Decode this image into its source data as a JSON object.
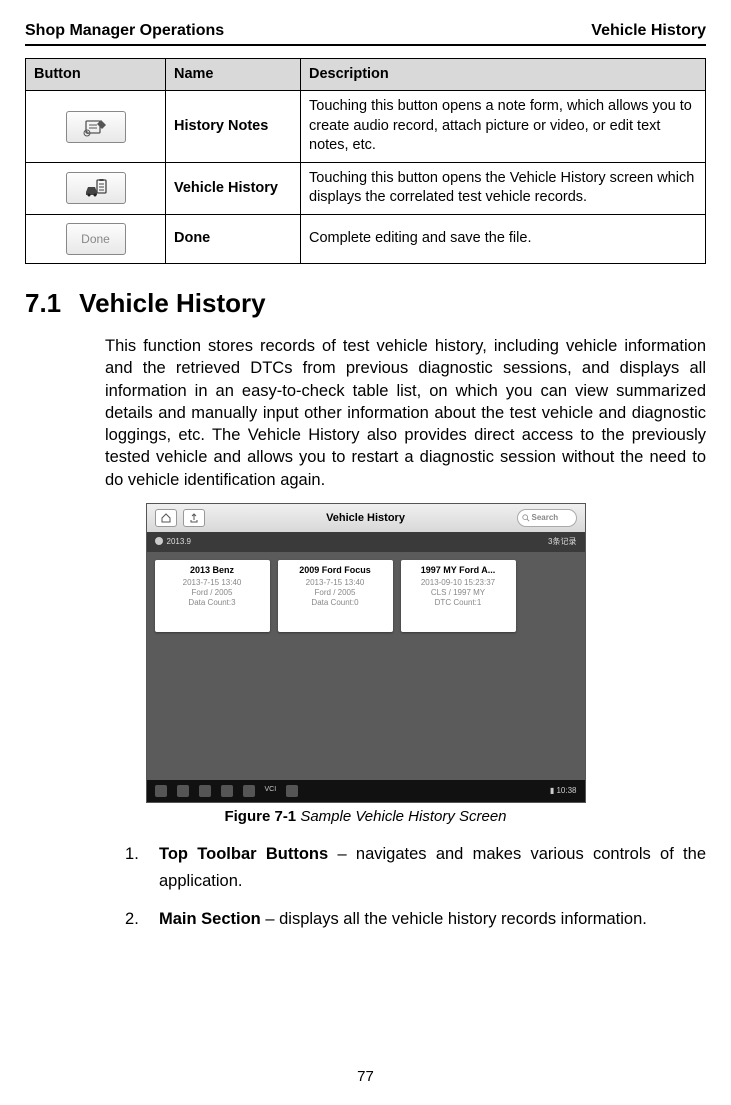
{
  "header": {
    "left": "Shop Manager Operations",
    "right": "Vehicle History"
  },
  "table": {
    "headers": [
      "Button",
      "Name",
      "Description"
    ],
    "rows": [
      {
        "icon": "history-notes-icon",
        "name": "History Notes",
        "desc": "Touching this button opens a note form, which allows you to create audio record, attach picture or video, or edit text notes, etc."
      },
      {
        "icon": "vehicle-history-icon",
        "name": "Vehicle History",
        "desc": "Touching this button opens the Vehicle History screen which displays the correlated test vehicle records."
      },
      {
        "icon": "done-button-icon",
        "icon_label": "Done",
        "name": "Done",
        "desc": "Complete editing and save the file."
      }
    ]
  },
  "section": {
    "number": "7.1",
    "title": "Vehicle History",
    "body": "This function stores records of test vehicle history, including vehicle information and the retrieved DTCs from previous diagnostic sessions, and displays all information in an easy-to-check table list, on which you can view summarized details and manually input other information about the test vehicle and diagnostic loggings, etc. The Vehicle History also provides direct access to the previously tested vehicle and allows you to restart a diagnostic session without the need to do vehicle identification again."
  },
  "screenshot": {
    "title": "Vehicle History",
    "search_placeholder": "Search",
    "sub_left": "2013.9",
    "sub_right": "3条记录",
    "cards": [
      {
        "title": "2013 Benz",
        "l1": "2013-7-15 13:40",
        "l2": "Ford / 2005",
        "l3": "Data Count:3"
      },
      {
        "title": "2009 Ford Focus",
        "l1": "2013-7-15 13:40",
        "l2": "Ford / 2005",
        "l3": "Data Count:0"
      },
      {
        "title": "1997 MY Ford A...",
        "l1": "2013-09-10 15:23:37",
        "l2": "CLS / 1997 MY",
        "l3": "DTC Count:1"
      }
    ],
    "bottom_label": "VCI",
    "bottom_time": "10:38"
  },
  "figure_caption": {
    "bold": "Figure 7-1",
    "italic": " Sample Vehicle History Screen"
  },
  "list": [
    {
      "bold": "Top Toolbar Buttons",
      "rest": " – navigates and makes various controls of the application."
    },
    {
      "bold": "Main Section",
      "rest": " – displays all the vehicle history records information."
    }
  ],
  "page_number": "77"
}
